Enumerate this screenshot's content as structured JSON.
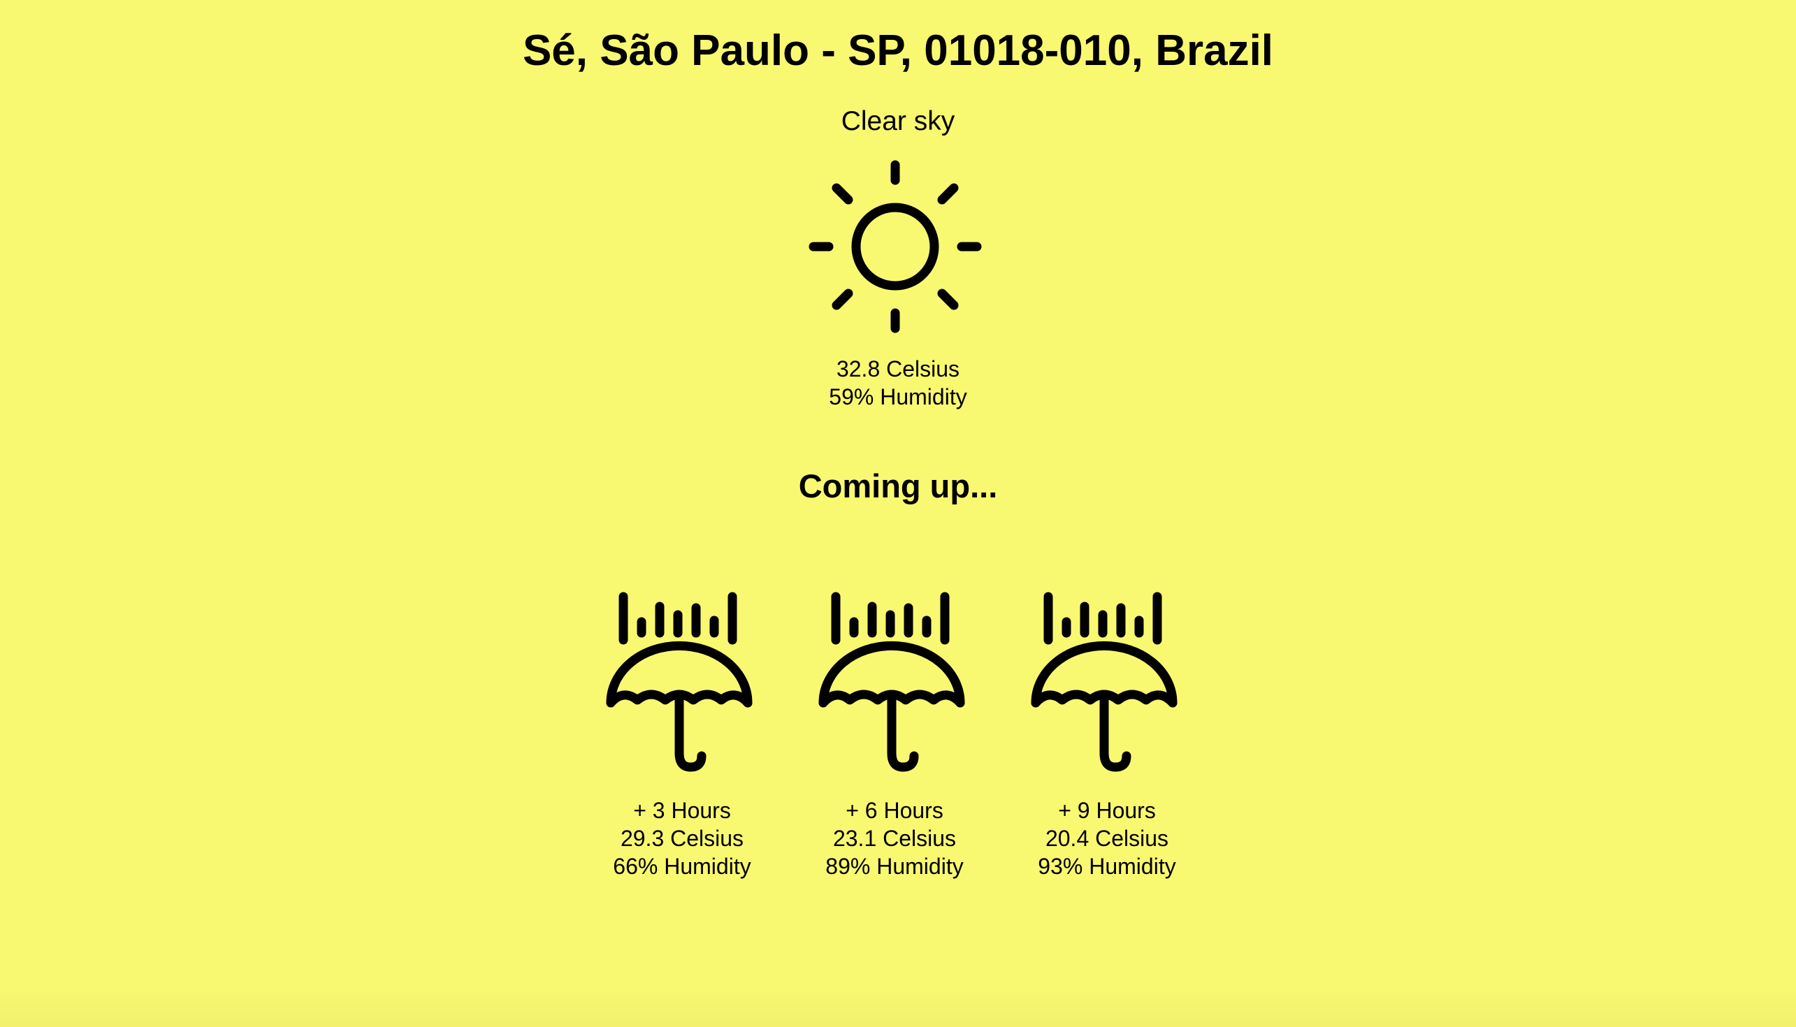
{
  "location": "Sé, São Paulo - SP, 01018-010, Brazil",
  "current": {
    "condition": "Clear sky",
    "icon": "sun-icon",
    "temperature": "32.8 Celsius",
    "humidity": "59% Humidity"
  },
  "coming_heading": "Coming up...",
  "forecast": [
    {
      "offset": "+ 3 Hours",
      "temperature": "29.3 Celsius",
      "humidity": "66% Humidity",
      "icon": "umbrella-rain-icon"
    },
    {
      "offset": "+ 6 Hours",
      "temperature": "23.1 Celsius",
      "humidity": "89% Humidity",
      "icon": "umbrella-rain-icon"
    },
    {
      "offset": "+ 9 Hours",
      "temperature": "20.4 Celsius",
      "humidity": "93% Humidity",
      "icon": "umbrella-rain-icon"
    }
  ],
  "colors": {
    "background": "#f9f871",
    "foreground": "#000000"
  }
}
